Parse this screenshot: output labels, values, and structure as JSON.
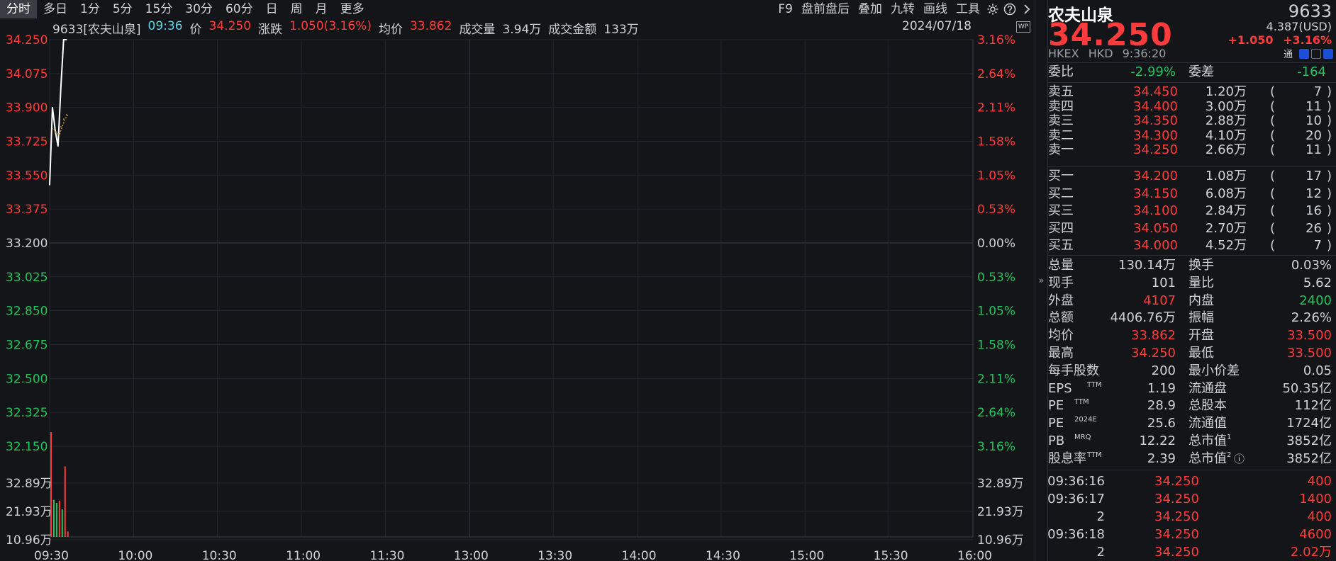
{
  "toolbar": {
    "timeframes": [
      "分时",
      "多日",
      "1分",
      "5分",
      "15分",
      "30分",
      "60分",
      "日",
      "周",
      "月",
      "更多"
    ],
    "active": "分时",
    "right_items": [
      "F9",
      "盘前盘后",
      "叠加",
      "九转",
      "画线",
      "工具"
    ],
    "right_icons": [
      "gear-icon",
      "help-icon",
      "chevron-right-icon"
    ]
  },
  "info_bar": {
    "symbol": "9633[农夫山泉]",
    "time": "09:36",
    "price_label": "价",
    "price": "34.250",
    "change_label": "涨跌",
    "change": "1.050(3.16%)",
    "avg_label": "均价",
    "avg": "33.862",
    "volume_label": "成交量",
    "volume": "3.94万",
    "amount_label": "成交金额",
    "amount": "133万",
    "date": "2024/07/18",
    "badge": "WP"
  },
  "chart_data": {
    "type": "line",
    "title": "",
    "y_price_ticks": [
      "34.250",
      "34.075",
      "33.900",
      "33.725",
      "33.550",
      "33.375",
      "33.200",
      "33.025",
      "32.850",
      "32.675",
      "32.500",
      "32.325",
      "32.150"
    ],
    "y_pct_ticks": [
      "3.16%",
      "2.64%",
      "2.11%",
      "1.58%",
      "1.05%",
      "0.53%",
      "0.00%",
      "0.53%",
      "1.05%",
      "1.58%",
      "2.11%",
      "2.64%",
      "3.16%"
    ],
    "prev_close": 33.2,
    "ylim": [
      32.15,
      34.25
    ],
    "x_ticks": [
      "09:30",
      "10:00",
      "10:30",
      "11:00",
      "11:30",
      "13:00",
      "13:30",
      "14:00",
      "14:30",
      "15:00",
      "15:30",
      "16:00"
    ],
    "series": [
      {
        "name": "价",
        "x": [
          "09:30",
          "09:31",
          "09:32",
          "09:33",
          "09:34",
          "09:35",
          "09:36"
        ],
        "values": [
          33.5,
          33.9,
          33.78,
          33.7,
          34.0,
          34.25,
          34.25
        ]
      },
      {
        "name": "均价",
        "x": [
          "09:31",
          "09:32",
          "09:33",
          "09:34",
          "09:35",
          "09:36"
        ],
        "values": [
          33.79,
          33.77,
          33.76,
          33.8,
          33.84,
          33.862
        ]
      }
    ],
    "volume_ticks": [
      "32.89万",
      "21.93万",
      "10.96万"
    ],
    "volume_ylim": [
      0,
      43.85
    ],
    "volume_bars": [
      {
        "x": "09:30",
        "value": 43.85,
        "color": "red"
      },
      {
        "x": "09:31",
        "value": 15.5,
        "color": "green"
      },
      {
        "x": "09:32",
        "value": 14.2,
        "color": "green"
      },
      {
        "x": "09:33",
        "value": 15.2,
        "color": "red"
      },
      {
        "x": "09:34",
        "value": 11.5,
        "color": "green"
      },
      {
        "x": "09:35",
        "value": 29.5,
        "color": "red"
      },
      {
        "x": "09:36",
        "value": 2.3,
        "color": "red"
      }
    ],
    "grid": true,
    "colors": {
      "up": "#ff3b3b",
      "down": "#22c55e",
      "flat": "#cfd2d6",
      "price_line": "#ffffff",
      "avg_line": "#e0a040"
    }
  },
  "quote": {
    "name": "农夫山泉",
    "code": "9633",
    "price": "34.250",
    "usd": "4.387(USD)",
    "change": "+1.050",
    "change_pct": "+3.16%",
    "market": "HKEX",
    "currency": "HKD",
    "time": "9:36:20",
    "tong": "通",
    "weibi_label": "委比",
    "weibi": "-2.99%",
    "weicha_label": "委差",
    "weicha": "-164"
  },
  "order_book": {
    "asks": [
      {
        "label": "卖五",
        "price": "34.450",
        "vol": "1.20万",
        "count": "7"
      },
      {
        "label": "卖四",
        "price": "34.400",
        "vol": "3.00万",
        "count": "11"
      },
      {
        "label": "卖三",
        "price": "34.350",
        "vol": "2.88万",
        "count": "10"
      },
      {
        "label": "卖二",
        "price": "34.300",
        "vol": "4.10万",
        "count": "20"
      },
      {
        "label": "卖一",
        "price": "34.250",
        "vol": "2.66万",
        "count": "11"
      }
    ],
    "bids": [
      {
        "label": "买一",
        "price": "34.200",
        "vol": "1.08万",
        "count": "17"
      },
      {
        "label": "买二",
        "price": "34.150",
        "vol": "6.08万",
        "count": "12"
      },
      {
        "label": "买三",
        "price": "34.100",
        "vol": "2.84万",
        "count": "16"
      },
      {
        "label": "买四",
        "price": "34.050",
        "vol": "2.70万",
        "count": "26"
      },
      {
        "label": "买五",
        "price": "34.000",
        "vol": "4.52万",
        "count": "7"
      }
    ]
  },
  "stats": [
    {
      "l1": "总量",
      "v1": "130.14万",
      "c1": "w",
      "l2": "换手",
      "v2": "0.03%",
      "c2": "w"
    },
    {
      "l1": "现手",
      "v1": "101",
      "c1": "w",
      "l2": "量比",
      "v2": "5.62",
      "c2": "w"
    },
    {
      "l1": "外盘",
      "v1": "4107",
      "c1": "r",
      "l2": "内盘",
      "v2": "2400",
      "c2": "g"
    },
    {
      "l1": "总额",
      "v1": "4406.76万",
      "c1": "w",
      "l2": "振幅",
      "v2": "2.26%",
      "c2": "w"
    },
    {
      "l1": "均价",
      "v1": "33.862",
      "c1": "r",
      "l2": "开盘",
      "v2": "33.500",
      "c2": "r"
    },
    {
      "l1": "最高",
      "v1": "34.250",
      "c1": "r",
      "l2": "最低",
      "v2": "33.500",
      "c2": "r"
    },
    {
      "l1": "每手股数",
      "v1": "200",
      "c1": "w",
      "l2": "最小价差",
      "v2": "0.05",
      "c2": "w"
    },
    {
      "l1": "EPS",
      "s1": "TTM",
      "v1": "1.19",
      "c1": "w",
      "l2": "流通盘",
      "v2": "50.35亿",
      "c2": "w"
    },
    {
      "l1": "PE",
      "s1": "TTM",
      "v1": "28.9",
      "c1": "w",
      "l2": "总股本",
      "v2": "112亿",
      "c2": "w"
    },
    {
      "l1": "PE",
      "s1": "2024E",
      "v1": "25.6",
      "c1": "w",
      "l2": "流通值",
      "v2": "1724亿",
      "c2": "w"
    },
    {
      "l1": "PB",
      "s1": "MRQ",
      "v1": "12.22",
      "c1": "w",
      "l2": "总市值",
      "s2": "1",
      "v2": "3852亿",
      "c2": "w"
    },
    {
      "l1": "股息率",
      "s1": "TTM",
      "v1": "2.39",
      "c1": "w",
      "l2": "总市值",
      "s2": "2",
      "v2": "3852亿",
      "c2": "w"
    }
  ],
  "ticks": [
    {
      "time": "09:36:16",
      "price": "34.250",
      "vol": "400"
    },
    {
      "time": "09:36:17",
      "price": "34.250",
      "vol": "1400"
    },
    {
      "time": "2",
      "price": "34.250",
      "vol": "400"
    },
    {
      "time": "09:36:18",
      "price": "34.250",
      "vol": "4600"
    },
    {
      "time": "2",
      "price": "34.250",
      "vol": "2.02万"
    }
  ]
}
